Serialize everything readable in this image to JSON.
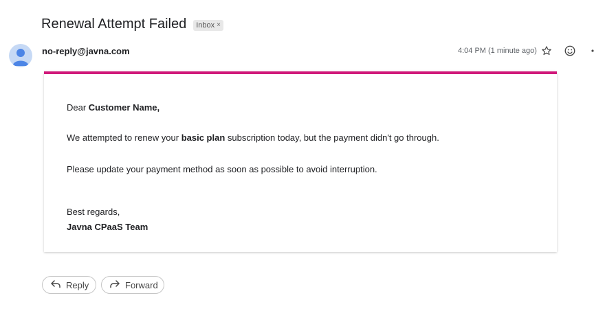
{
  "email": {
    "subject": "Renewal Attempt Failed",
    "label": "Inbox",
    "label_remove": "×",
    "sender": "no-reply@javna.com",
    "time": "4:04 PM (1 minute ago)"
  },
  "icons": [
    "avatar-icon",
    "star-icon",
    "emoji-icon",
    "more-icon",
    "reply-icon",
    "forward-icon"
  ],
  "colors": {
    "accent_bar": "#d0187a"
  },
  "body": {
    "greeting_prefix": "Dear ",
    "greeting_name": "Customer Name,",
    "line1_prefix": "We attempted to renew your ",
    "line1_bold": "basic plan",
    "line1_suffix": " subscription today,  but the payment didn't go through.",
    "line2": "Please update your payment method as soon as possible to avoid interruption.",
    "regards": "Best regards,",
    "team": "Javna CPaaS Team"
  },
  "actions": {
    "reply": "Reply",
    "forward": "Forward"
  }
}
